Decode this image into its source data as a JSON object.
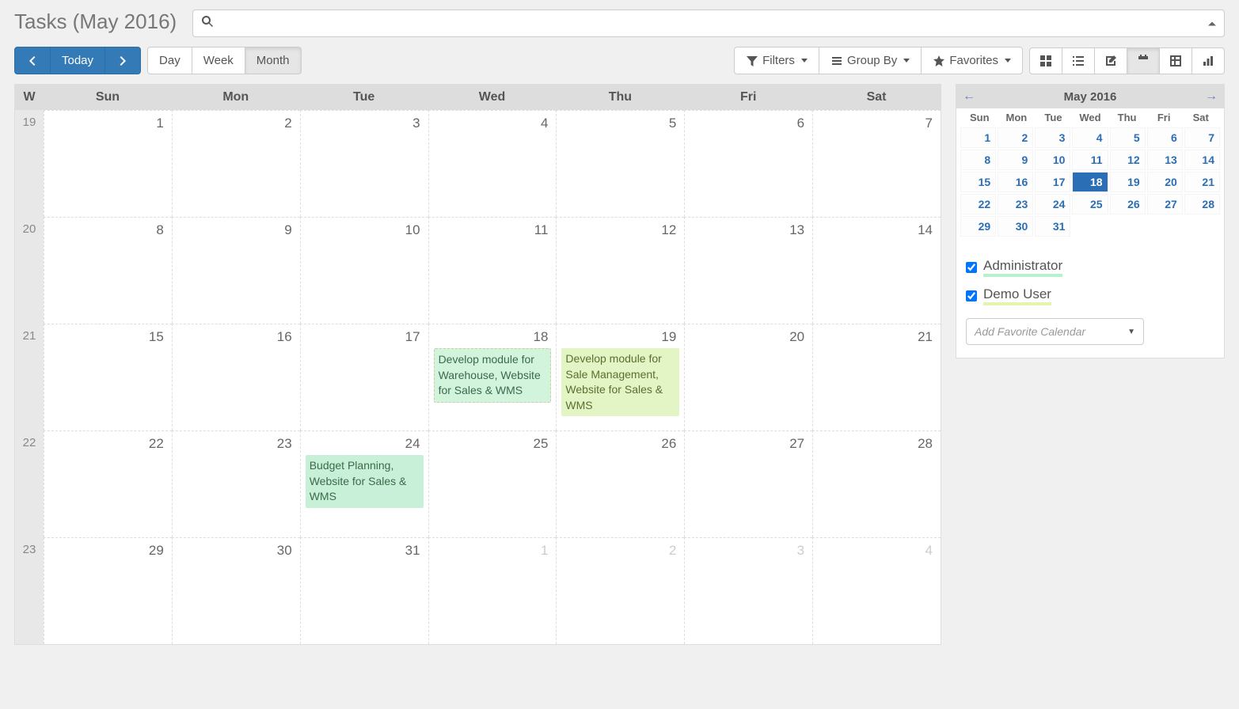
{
  "page_title": "Tasks (May 2016)",
  "nav": {
    "today": "Today",
    "day": "Day",
    "week": "Week",
    "month": "Month"
  },
  "toolbar": {
    "filters": "Filters",
    "group_by": "Group By",
    "favorites": "Favorites"
  },
  "search": {
    "placeholder": ""
  },
  "calendar": {
    "headers": [
      "W",
      "Sun",
      "Mon",
      "Tue",
      "Wed",
      "Thu",
      "Fri",
      "Sat"
    ],
    "rows": [
      {
        "week": "19",
        "days": [
          {
            "n": "1"
          },
          {
            "n": "2"
          },
          {
            "n": "3"
          },
          {
            "n": "4"
          },
          {
            "n": "5"
          },
          {
            "n": "6"
          },
          {
            "n": "7"
          }
        ]
      },
      {
        "week": "20",
        "days": [
          {
            "n": "8"
          },
          {
            "n": "9"
          },
          {
            "n": "10"
          },
          {
            "n": "11"
          },
          {
            "n": "12"
          },
          {
            "n": "13"
          },
          {
            "n": "14"
          }
        ]
      },
      {
        "week": "21",
        "days": [
          {
            "n": "15"
          },
          {
            "n": "16"
          },
          {
            "n": "17"
          },
          {
            "n": "18",
            "events": [
              {
                "text": "Develop module for Warehouse, Website for Sales & WMS",
                "cls": "ev-green"
              }
            ]
          },
          {
            "n": "19",
            "events": [
              {
                "text": "Develop module for Sale Management, Website for Sales & WMS",
                "cls": "ev-lime"
              }
            ]
          },
          {
            "n": "20"
          },
          {
            "n": "21"
          }
        ]
      },
      {
        "week": "22",
        "days": [
          {
            "n": "22"
          },
          {
            "n": "23"
          },
          {
            "n": "24",
            "events": [
              {
                "text": "Budget Planning, Website for Sales & WMS",
                "cls": "ev-mint"
              }
            ]
          },
          {
            "n": "25"
          },
          {
            "n": "26"
          },
          {
            "n": "27"
          },
          {
            "n": "28"
          }
        ]
      },
      {
        "week": "23",
        "days": [
          {
            "n": "29"
          },
          {
            "n": "30"
          },
          {
            "n": "31"
          },
          {
            "n": "1",
            "other": true
          },
          {
            "n": "2",
            "other": true
          },
          {
            "n": "3",
            "other": true
          },
          {
            "n": "4",
            "other": true
          }
        ]
      }
    ]
  },
  "mini": {
    "title": "May 2016",
    "days": [
      "Sun",
      "Mon",
      "Tue",
      "Wed",
      "Thu",
      "Fri",
      "Sat"
    ],
    "cells": [
      1,
      2,
      3,
      4,
      5,
      6,
      7,
      8,
      9,
      10,
      11,
      12,
      13,
      14,
      15,
      16,
      17,
      18,
      19,
      20,
      21,
      22,
      23,
      24,
      25,
      26,
      27,
      28,
      29,
      30,
      31
    ],
    "today": 18
  },
  "users": [
    {
      "name": "Administrator",
      "cls": "u-admin",
      "checked": true
    },
    {
      "name": "Demo User",
      "cls": "u-demo",
      "checked": true
    }
  ],
  "fav_placeholder": "Add Favorite Calendar"
}
